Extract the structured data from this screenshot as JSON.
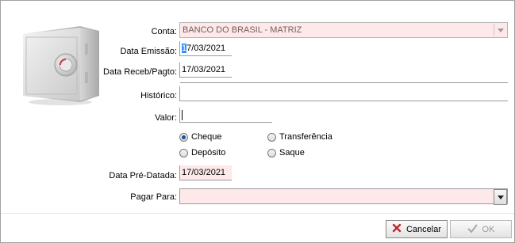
{
  "form": {
    "conta_label": "Conta:",
    "conta_value": "BANCO DO BRASIL - MATRIZ",
    "data_emissao_label": "Data Emissão:",
    "data_emissao_value": "17/03/2021",
    "data_emissao_first": "1",
    "data_emissao_rest": "7/03/2021",
    "data_receb_label": "Data Receb/Pagto:",
    "data_receb_value": "17/03/2021",
    "historico_label": "Histórico:",
    "historico_value": "",
    "valor_label": "Valor:",
    "valor_value": "",
    "data_pre_label": "Data Pré-Datada:",
    "data_pre_value": "17/03/2021",
    "pagar_para_label": "Pagar Para:",
    "pagar_para_value": ""
  },
  "payment_type": {
    "options": [
      "Cheque",
      "Transferência",
      "Depósito",
      "Saque"
    ],
    "selected": "Cheque"
  },
  "buttons": {
    "cancel_label": "Cancelar",
    "ok_label": "OK"
  },
  "colors": {
    "pink_field": "#fde9e9",
    "radio_dot": "#1c4f9a",
    "cancel_x": "#c0262d"
  },
  "icons": {
    "safe": "safe-icon",
    "cancel": "x-icon",
    "ok": "check-icon",
    "dropdown": "chevron-down-icon"
  }
}
